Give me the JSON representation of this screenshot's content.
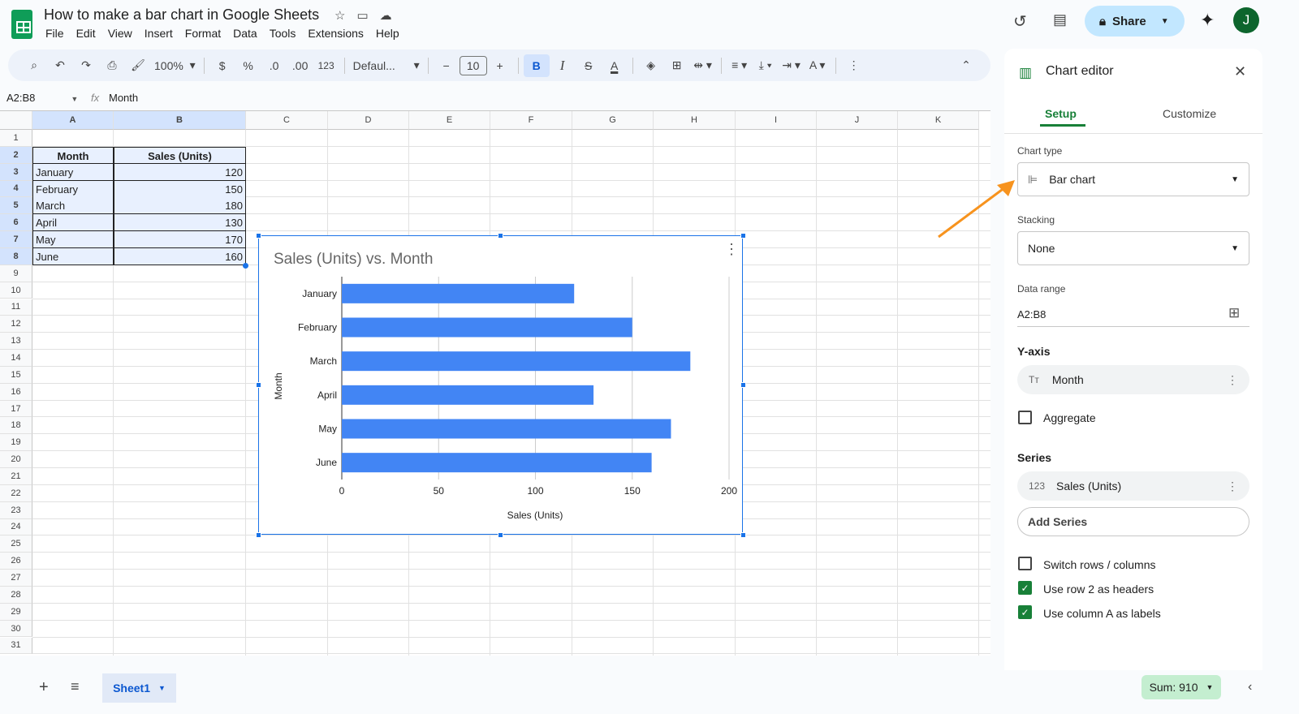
{
  "doc": {
    "title": "How to make a bar chart in Google Sheets",
    "menu": [
      "File",
      "Edit",
      "View",
      "Insert",
      "Format",
      "Data",
      "Tools",
      "Extensions",
      "Help"
    ],
    "share": "Share",
    "avatar": "J"
  },
  "toolbar": {
    "zoom": "100%",
    "currency": "$",
    "percent": "%",
    "dec_less": ".0",
    "dec_more": ".00",
    "format123": "123",
    "font": "Defaul...",
    "font_size": "10",
    "bold": "B",
    "italic": "I"
  },
  "formula": {
    "namebox": "A2:B8",
    "fx": "fx",
    "value": "Month"
  },
  "columns": [
    "A",
    "B",
    "C",
    "D",
    "E",
    "F",
    "G",
    "H",
    "I",
    "J",
    "K"
  ],
  "table": {
    "headers": [
      "Month",
      "Sales (Units)"
    ],
    "rows": [
      [
        "January",
        "120"
      ],
      [
        "February",
        "150"
      ],
      [
        "March",
        "180"
      ],
      [
        "April",
        "130"
      ],
      [
        "May",
        "170"
      ],
      [
        "June",
        "160"
      ]
    ]
  },
  "chart_data": {
    "type": "bar",
    "orientation": "horizontal",
    "title": "Sales (Units) vs. Month",
    "categories": [
      "January",
      "February",
      "March",
      "April",
      "May",
      "June"
    ],
    "values": [
      120,
      150,
      180,
      130,
      170,
      160
    ],
    "xlabel": "Sales (Units)",
    "ylabel": "Month",
    "xlim": [
      0,
      200
    ],
    "xticks": [
      "0",
      "50",
      "100",
      "150",
      "200"
    ],
    "color": "#4285f4"
  },
  "editor": {
    "title": "Chart editor",
    "tabs": [
      "Setup",
      "Customize"
    ],
    "chart_type_label": "Chart type",
    "chart_type": "Bar chart",
    "stacking_label": "Stacking",
    "stacking": "None",
    "data_range_label": "Data range",
    "data_range": "A2:B8",
    "yaxis_label": "Y-axis",
    "yaxis": "Month",
    "aggregate": "Aggregate",
    "series_label": "Series",
    "series": "Sales (Units)",
    "add_series": "Add Series",
    "switch": "Switch rows / columns",
    "use_row": "Use row 2 as headers",
    "use_col": "Use column A as labels"
  },
  "footer": {
    "sheet": "Sheet1",
    "sum": "Sum: 910"
  }
}
